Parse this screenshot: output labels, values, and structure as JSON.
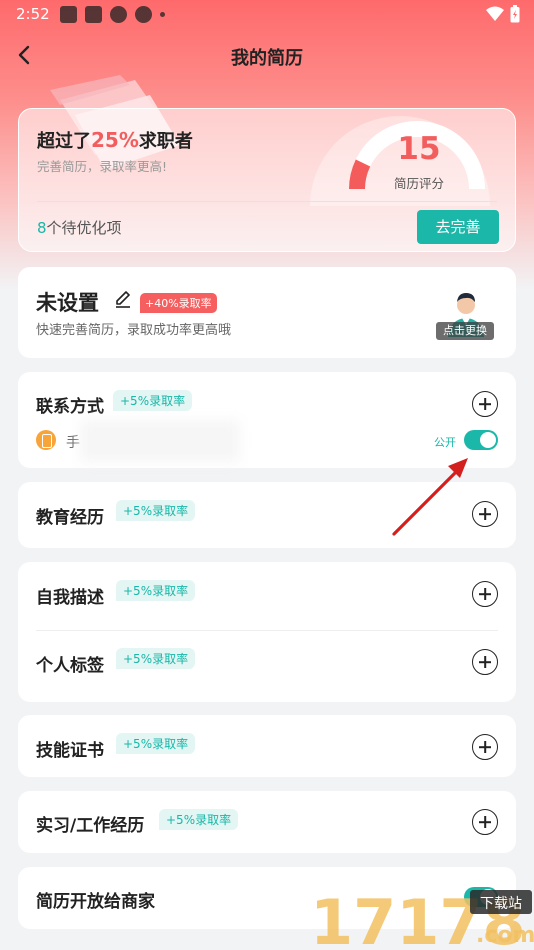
{
  "status_bar": {
    "time": "2:52"
  },
  "nav": {
    "title": "我的简历"
  },
  "score_card": {
    "title_prefix": "超过了",
    "percent": "25%",
    "title_suffix": "求职者",
    "subtitle": "完善简历，录取率更高!",
    "score": "15",
    "score_label": "简历评分",
    "todo_count": "8",
    "todo_text": "个待优化项",
    "complete_button": "去完善"
  },
  "profile": {
    "name": "未设置",
    "badge": "+40%录取率",
    "subtitle": "快速完善简历，录取成功率更高哦",
    "avatar_label": "点击更换"
  },
  "sections": {
    "contact": {
      "title": "联系方式",
      "badge": "+5%录取率",
      "phone_prefix": "手",
      "public_label": "公开",
      "public_on": true
    },
    "education": {
      "title": "教育经历",
      "badge": "+5%录取率"
    },
    "self_desc": {
      "title": "自我描述",
      "badge": "+5%录取率"
    },
    "tags": {
      "title": "个人标签",
      "badge": "+5%录取率"
    },
    "certificates": {
      "title": "技能证书",
      "badge": "+5%录取率"
    },
    "work": {
      "title": "实习/工作经历",
      "badge": "+5%录取率"
    },
    "open_to_merchants": {
      "title": "简历开放给商家",
      "enabled": true
    }
  },
  "watermark": {
    "number": "17178",
    "suffix": ".com",
    "tag": "下载站"
  },
  "colors": {
    "accent": "#1bb8aa",
    "red": "#f25d5d",
    "header": "#fe6a6c"
  }
}
